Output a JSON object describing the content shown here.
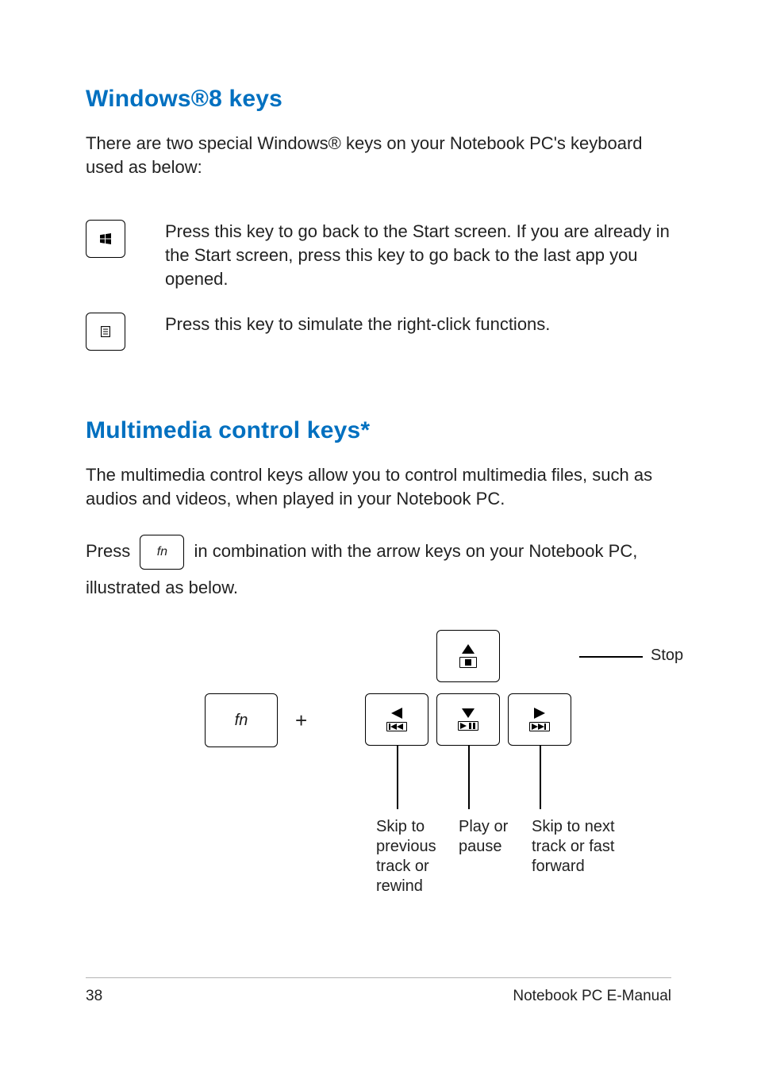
{
  "headings": {
    "h1": "Windows®8 keys",
    "h2": "Multimedia control keys*"
  },
  "paragraphs": {
    "intro_win": "There are two special Windows® keys on your Notebook PC's keyboard used as below:",
    "win_key_desc": "Press this key to go back to the Start screen. If you are already in the Start screen, press this key to go back to the last app you opened.",
    "menu_key_desc": "Press this key to simulate the right-click functions.",
    "intro_mm": "The multimedia control keys allow you to control multimedia files, such as audios and videos, when played in your Notebook PC.",
    "press_line_pre": "Press ",
    "press_line_post": " in combination with the arrow keys on your Notebook PC, illustrated as below."
  },
  "keys": {
    "fn": "fn",
    "plus": "+"
  },
  "callouts": {
    "stop": "Stop",
    "prev": "Skip to previous track or rewind",
    "play": "Play or pause",
    "next": "Skip to next track or fast forward"
  },
  "footer": {
    "page": "38",
    "title": "Notebook PC E-Manual"
  }
}
